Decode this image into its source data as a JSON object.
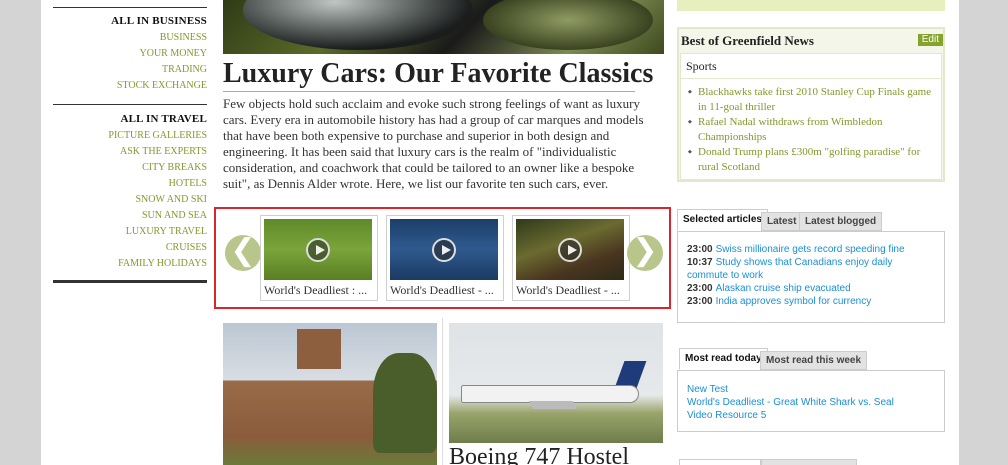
{
  "leftnav": {
    "business": {
      "heading": "ALL IN BUSINESS",
      "items": [
        "BUSINESS",
        "YOUR MONEY",
        "TRADING",
        "STOCK EXCHANGE"
      ]
    },
    "travel": {
      "heading": "ALL IN TRAVEL",
      "items": [
        "PICTURE GALLERIES",
        "ASK THE EXPERTS",
        "CITY BREAKS",
        "HOTELS",
        "SNOW AND SKI",
        "SUN AND SEA",
        "LUXURY TRAVEL",
        "CRUISES",
        "FAMILY HOLIDAYS"
      ]
    }
  },
  "article": {
    "title": "Luxury Cars: Our Favorite Classics",
    "intro": "Few objects hold such acclaim and evoke such strong feelings of want as luxury cars. Every era in automobile history has had a group of car marques and models that have been both expensive to purchase and superior in both design and engineering. It has been said that luxury cars is the realm of \"individualistic consideration, and coachwork that could be tailored to an owner like a bespoke suit\", as Dennis Alder wrote. Here, we list our favorite ten such cars, ever."
  },
  "carousel": {
    "prev_icon": "❮",
    "next_icon": "❯",
    "videos": [
      {
        "caption": "World's Deadliest : ..."
      },
      {
        "caption": "World's Deadliest - ..."
      },
      {
        "caption": "World's Deadliest - ..."
      }
    ]
  },
  "lower": {
    "second_title": "Boeing 747 Hostel"
  },
  "best": {
    "heading": "Best of Greenfield News",
    "edit_label": "Edit",
    "section": "Sports",
    "items": [
      "Blackhawks take first 2010 Stanley Cup Finals game in 11-goal thriller",
      "Rafael Nadal withdraws from Wimbledon Championships",
      "Donald Trump plans £300m \"golfing paradise\" for rural Scotland"
    ]
  },
  "articles_tabs": {
    "tabs": [
      "Selected articles",
      "Latest",
      "Latest blogged"
    ],
    "rows": [
      {
        "time": "23:00",
        "text": "Swiss millionaire gets record speeding fine"
      },
      {
        "time": "10:37",
        "text": "Study shows that Canadians enjoy daily commute to work"
      },
      {
        "time": "23:00",
        "text": "Alaskan cruise ship evacuated"
      },
      {
        "time": "23:00",
        "text": "India approves symbol for currency"
      }
    ]
  },
  "read_tabs": {
    "tabs": [
      "Most read today",
      "Most read this week"
    ],
    "items": [
      "New Test",
      "World's Deadliest - Great White Shark vs. Seal",
      "Video Resource 5"
    ]
  },
  "colors": {
    "accent_green": "#7f9a2c",
    "link_blue": "#1a8fd6",
    "carousel_border": "#d7262d"
  }
}
